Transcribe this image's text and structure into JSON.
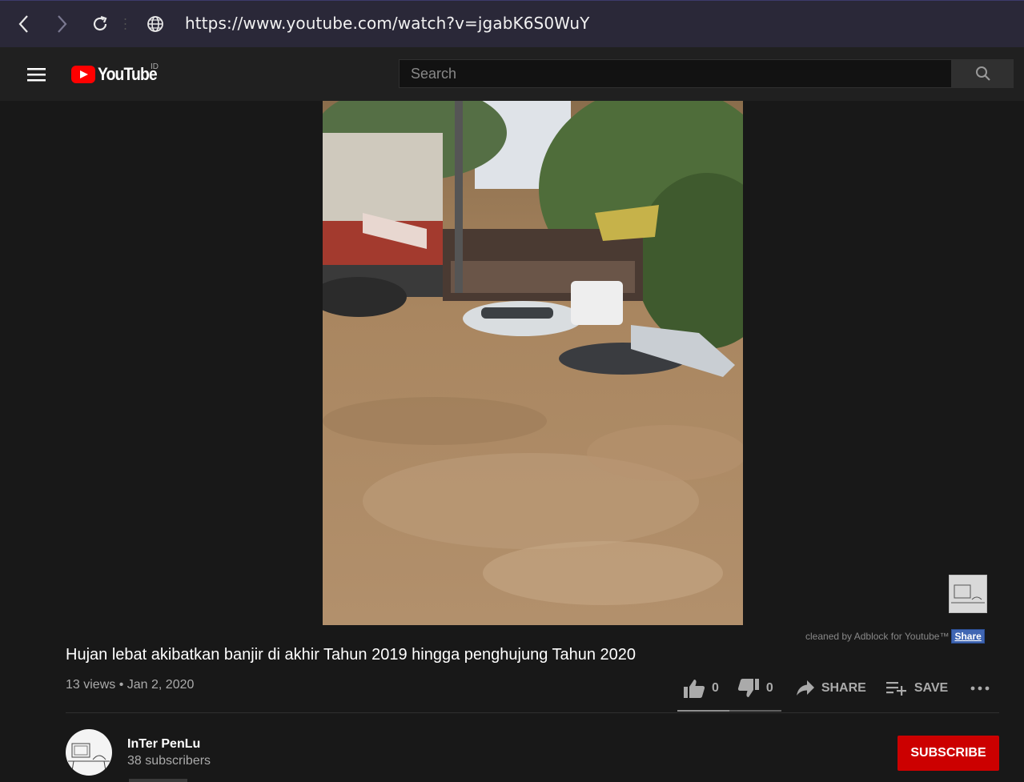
{
  "browser": {
    "url": "https://www.youtube.com/watch?v=jgabK6S0WuY"
  },
  "header": {
    "logo_text": "YouTube",
    "region": "ID",
    "search_placeholder": "Search"
  },
  "video": {
    "title": "Hujan lebat akibatkan banjir di akhir Tahun 2019 hingga penghujung Tahun 2020",
    "views": "13 views",
    "separator": "•",
    "date": "Jan 2, 2020",
    "likes": "0",
    "dislikes": "0",
    "share_label": "SHARE",
    "save_label": "SAVE"
  },
  "adblock": {
    "text": "cleaned by Adblock for Youtube™",
    "share_label": "Share"
  },
  "channel": {
    "name": "InTer PenLu",
    "subscribers": "38 subscribers",
    "subscribe_label": "SUBSCRIBE"
  },
  "colors": {
    "brand_red": "#ff0000",
    "subscribe_red": "#cc0000",
    "background": "#181818"
  }
}
